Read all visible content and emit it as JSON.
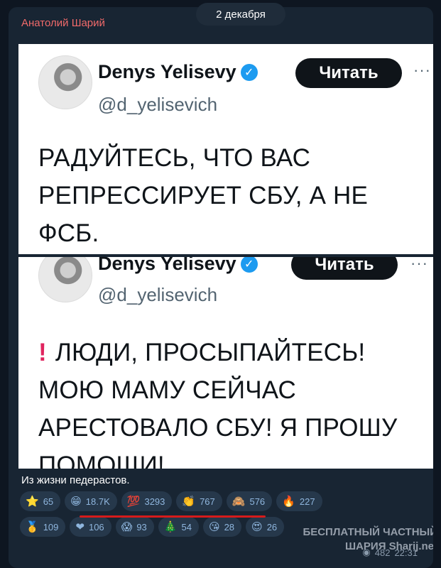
{
  "message": {
    "sender": "Анатолий Шарий",
    "date": "2 декабря",
    "caption": "Из жизни педерастов."
  },
  "tweets": [
    {
      "name": "Denys Yelisevy",
      "handle": "@d_yelisevich",
      "follow_label": "Читать",
      "more": "···",
      "lines": [
        "РАДУЙТЕСЬ, ЧТО ВАС",
        "РЕПРЕССИРУЕТ СБУ, А НЕ",
        "ФСБ."
      ]
    },
    {
      "name": "Denys Yelisevy",
      "handle": "@d_yelisevich",
      "follow_label": "Читать",
      "more": "···",
      "exclaim": "!",
      "lines": [
        "ЛЮДИ, ПРОСЫПАЙТЕСЬ!",
        "МОЮ МАМУ СЕЙЧАС",
        "АРЕСТОВАЛО СБУ! Я ПРОШУ",
        "ПОМОЩИ!"
      ]
    }
  ],
  "reactions": {
    "row1": [
      {
        "emoji": "⭐",
        "count": "65",
        "icon": "star-icon"
      },
      {
        "emoji": "😁",
        "count": "18.7K",
        "icon": "grin-icon"
      },
      {
        "emoji": "💯",
        "count": "3293",
        "icon": "hundred-icon"
      },
      {
        "emoji": "👏",
        "count": "767",
        "icon": "clap-icon"
      },
      {
        "emoji": "🙈",
        "count": "576",
        "icon": "monkey-icon"
      },
      {
        "emoji": "🔥",
        "count": "227",
        "icon": "fire-icon"
      }
    ],
    "row2": [
      {
        "emoji": "🥇",
        "count": "109",
        "icon": "medal-icon"
      },
      {
        "emoji": "❤",
        "count": "106",
        "icon": "heart-icon"
      },
      {
        "emoji": "😱",
        "count": "93",
        "icon": "scream-icon"
      },
      {
        "emoji": "🎄",
        "count": "54",
        "icon": "tree-icon"
      },
      {
        "emoji": "😘",
        "count": "28",
        "icon": "kiss-icon"
      },
      {
        "emoji": "😍",
        "count": "26",
        "icon": "heart-eyes-icon"
      }
    ]
  },
  "watermark": {
    "line1": "БЕСПЛАТНЫЙ ЧАСТНЫЙ",
    "line2": "ШАРИЯ Sharij.net"
  },
  "meta": {
    "views": "482",
    "time": "22:31"
  },
  "colors": {
    "background": "#0e1621",
    "bubble": "#182533",
    "sender": "#f06a6a",
    "chip": "#26384b",
    "underline": "#d61b1b",
    "verified": "#1d9bf0"
  }
}
